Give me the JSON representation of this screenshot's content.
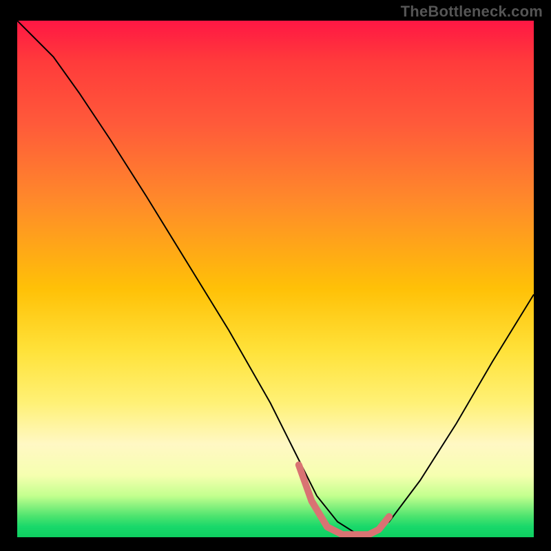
{
  "watermark": "TheBottleneck.com",
  "chart_data": {
    "type": "line",
    "title": "",
    "xlabel": "",
    "ylabel": "",
    "xlim": [
      0,
      100
    ],
    "ylim": [
      0,
      100
    ],
    "gradient_stops": [
      {
        "pct": 0,
        "color": "#ff1744"
      },
      {
        "pct": 8,
        "color": "#ff3b3b"
      },
      {
        "pct": 20,
        "color": "#ff5a3a"
      },
      {
        "pct": 35,
        "color": "#ff8a2a"
      },
      {
        "pct": 52,
        "color": "#ffc107"
      },
      {
        "pct": 64,
        "color": "#ffe23a"
      },
      {
        "pct": 74,
        "color": "#fff176"
      },
      {
        "pct": 82,
        "color": "#fff8c4"
      },
      {
        "pct": 88,
        "color": "#f6ffb0"
      },
      {
        "pct": 92,
        "color": "#c3ff8e"
      },
      {
        "pct": 96,
        "color": "#4be36e"
      },
      {
        "pct": 98,
        "color": "#18d86a"
      },
      {
        "pct": 100,
        "color": "#0ecf60"
      }
    ],
    "series": [
      {
        "name": "bottleneck-curve",
        "color": "#000000",
        "stroke_width": 2,
        "x": [
          0,
          3,
          7,
          12,
          18,
          25,
          33,
          41,
          49,
          54,
          58,
          62,
          66,
          68,
          72,
          78,
          85,
          92,
          100
        ],
        "y": [
          100,
          97,
          93,
          86,
          77,
          66,
          53,
          40,
          26,
          16,
          8,
          3,
          0.5,
          0.5,
          3,
          11,
          22,
          34,
          47
        ]
      }
    ],
    "highlight": {
      "name": "flat-min-segment",
      "color": "#d97373",
      "stroke_width": 10,
      "linecap": "round",
      "x": [
        54.5,
        57,
        60,
        63,
        66,
        68,
        70,
        72
      ],
      "y": [
        14,
        7,
        2,
        0.5,
        0.5,
        0.5,
        1.5,
        4
      ]
    }
  }
}
